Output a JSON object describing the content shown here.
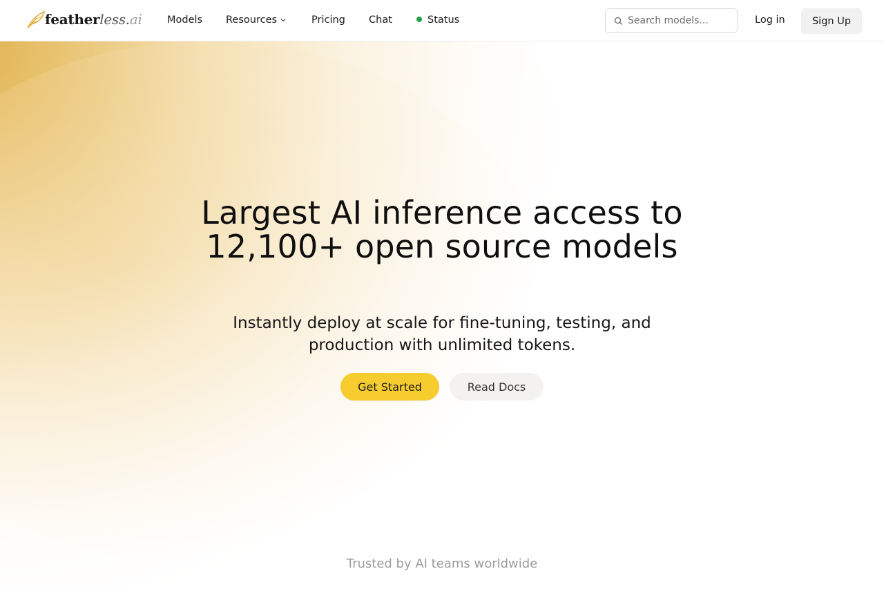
{
  "brand": {
    "name_bold": "feather",
    "name_light": "less",
    "name_dot": ".",
    "name_ai": "ai",
    "accent_color": "#f7cc2f",
    "glow_color": "#dda634"
  },
  "nav": {
    "items": [
      {
        "label": "Models"
      },
      {
        "label": "Resources",
        "icon": "chevron-down-icon"
      },
      {
        "label": "Pricing"
      },
      {
        "label": "Chat"
      },
      {
        "label": "Status",
        "status_color": "#22a04b"
      }
    ]
  },
  "search": {
    "placeholder": "Search models...",
    "value": "",
    "icon": "search-icon"
  },
  "auth": {
    "login_label": "Log in",
    "signup_label": "Sign Up"
  },
  "hero": {
    "title": "Largest AI inference access to 12,100+ open source models",
    "subtitle": "Instantly deploy at scale for fine-tuning, testing, and production with unlimited tokens.",
    "primary_cta": "Get Started",
    "secondary_cta": "Read Docs"
  },
  "trusted": {
    "text": "Trusted by AI teams worldwide"
  }
}
